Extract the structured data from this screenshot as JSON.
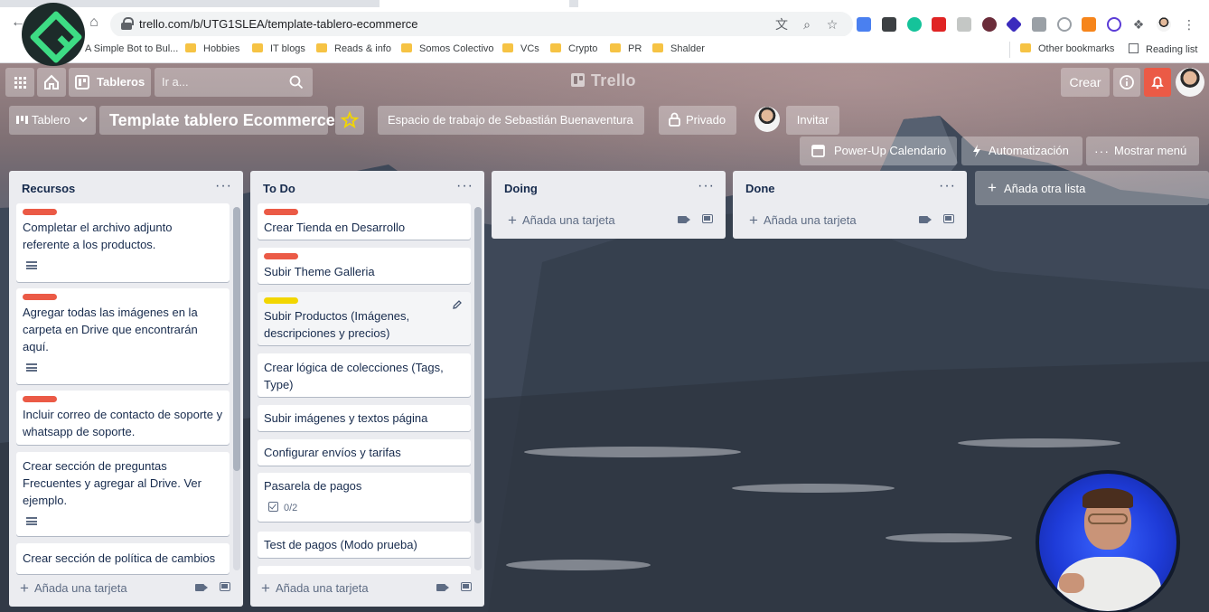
{
  "browser": {
    "url": "trello.com/b/UTG1SLEA/template-tablero-ecommerce",
    "bookmarks": [
      {
        "label": "A Simple Bot to Bul...",
        "type": "page"
      },
      {
        "label": "Hobbies",
        "type": "folder"
      },
      {
        "label": "IT blogs",
        "type": "folder"
      },
      {
        "label": "Reads & info",
        "type": "folder"
      },
      {
        "label": "Somos Colectivo",
        "type": "folder"
      },
      {
        "label": "VCs",
        "type": "folder"
      },
      {
        "label": "Crypto",
        "type": "folder"
      },
      {
        "label": "PR",
        "type": "folder"
      },
      {
        "label": "Shalder",
        "type": "folder"
      }
    ],
    "other_bookmarks": "Other bookmarks",
    "reading_list": "Reading list"
  },
  "header": {
    "boards_button": "Tableros",
    "search_placeholder": "Ir a...",
    "logo_text": "Trello",
    "create_button": "Crear"
  },
  "board": {
    "view_switcher": "Tablero",
    "title": "Template tablero Ecommerce",
    "workspace": "Espacio de trabajo de Sebastián Buenaventura",
    "visibility": "Privado",
    "invite": "Invitar",
    "calendar_powerup": "Power-Up Calendario",
    "automation": "Automatización",
    "show_menu": "Mostrar menú",
    "add_list": "Añada otra lista",
    "add_card": "Añada una tarjeta"
  },
  "colors": {
    "label_red": "#eb5a46",
    "label_yellow": "#f2d600",
    "notification_red": "#eb5a46"
  },
  "lists": [
    {
      "title": "Recursos",
      "cards": [
        {
          "text": "Completar el archivo adjunto referente a los productos.",
          "label": "red",
          "has_description": true
        },
        {
          "text": "Agregar todas las imágenes en la carpeta en Drive que encontrarán aquí.",
          "label": "red",
          "has_description": true
        },
        {
          "text": "Incluir correo de contacto de soporte y whatsapp de soporte.",
          "label": "red",
          "has_description": false
        },
        {
          "text": "Crear sección de preguntas Frecuentes y agregar al Drive. Ver ejemplo.",
          "label": null,
          "has_description": true
        },
        {
          "text": "Crear sección de política de cambios",
          "label": null,
          "has_description": false
        }
      ]
    },
    {
      "title": "To Do",
      "cards": [
        {
          "text": "Crear Tienda en Desarrollo",
          "label": "red"
        },
        {
          "text": "Subir Theme Galleria",
          "label": "red"
        },
        {
          "text": "Subir Productos (Imágenes, descripciones y precios)",
          "label": "yellow"
        },
        {
          "text": "Crear lógica de colecciones (Tags, Type)",
          "label": null
        },
        {
          "text": "Subir imágenes y textos página",
          "label": null
        },
        {
          "text": "Configurar envíos y tarifas",
          "label": null
        },
        {
          "text": "Pasarela de pagos",
          "label": null,
          "checklist": "0/2"
        },
        {
          "text": "Test de pagos (Modo prueba)",
          "label": null
        }
      ]
    },
    {
      "title": "Doing",
      "cards": []
    },
    {
      "title": "Done",
      "cards": []
    }
  ]
}
